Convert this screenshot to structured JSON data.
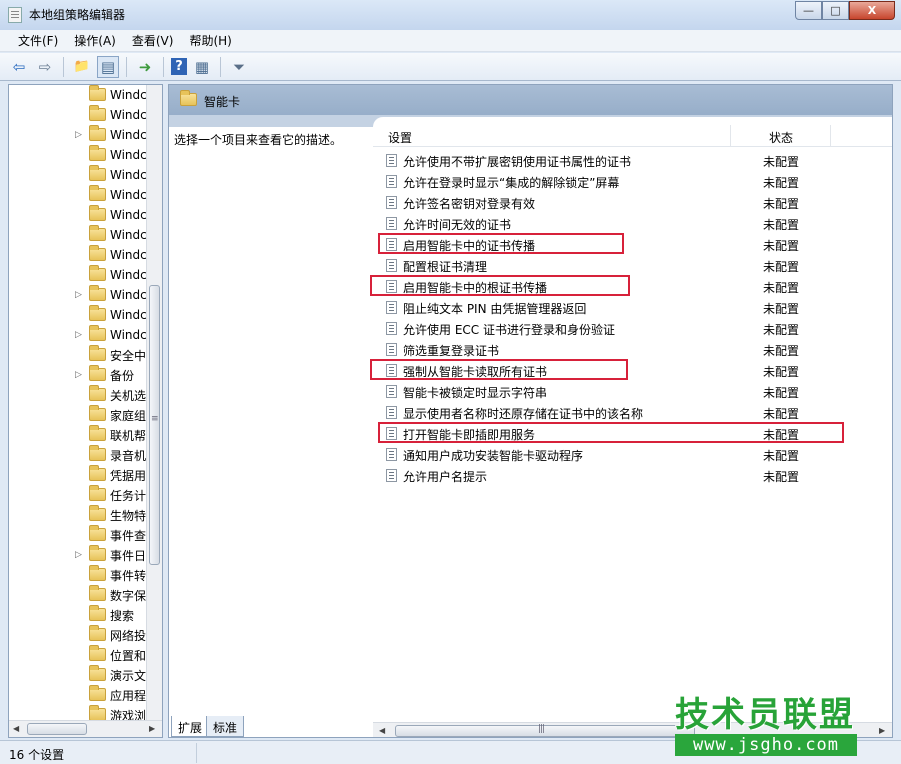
{
  "window": {
    "title": "本地组策略编辑器",
    "minimize": "—",
    "maximize": "□",
    "close": "X"
  },
  "menu": [
    "文件(F)",
    "操作(A)",
    "查看(V)",
    "帮助(H)"
  ],
  "toolbar": {
    "icons": [
      "back-arrow-icon",
      "forward-arrow-icon",
      "folder-up-icon",
      "show-hide-tree-icon",
      "export-list-icon",
      "help-icon",
      "properties-icon",
      "filter-icon"
    ],
    "glyphs": [
      "⇦",
      "⇨",
      "📁",
      "▤",
      "➜",
      "?",
      "▦",
      "⏷"
    ]
  },
  "tree": {
    "items": [
      {
        "label": "Windc",
        "expandable": false
      },
      {
        "label": "Windc",
        "expandable": false
      },
      {
        "label": "Windc",
        "expandable": true
      },
      {
        "label": "Windc",
        "expandable": false
      },
      {
        "label": "Windc",
        "expandable": false
      },
      {
        "label": "Windc",
        "expandable": false
      },
      {
        "label": "Windc",
        "expandable": false
      },
      {
        "label": "Windc",
        "expandable": false
      },
      {
        "label": "Windc",
        "expandable": false
      },
      {
        "label": "Windc",
        "expandable": false
      },
      {
        "label": "Windc",
        "expandable": true
      },
      {
        "label": "Windc",
        "expandable": false
      },
      {
        "label": "Windc",
        "expandable": true
      },
      {
        "label": "安全中",
        "expandable": false
      },
      {
        "label": "备份",
        "expandable": true
      },
      {
        "label": "关机选",
        "expandable": false
      },
      {
        "label": "家庭组",
        "expandable": false
      },
      {
        "label": "联机帮",
        "expandable": false
      },
      {
        "label": "录音机",
        "expandable": false
      },
      {
        "label": "凭据用",
        "expandable": false
      },
      {
        "label": "任务计",
        "expandable": false
      },
      {
        "label": "生物特",
        "expandable": false
      },
      {
        "label": "事件查",
        "expandable": false
      },
      {
        "label": "事件日",
        "expandable": true
      },
      {
        "label": "事件转",
        "expandable": false
      },
      {
        "label": "数字保",
        "expandable": false
      },
      {
        "label": "搜索",
        "expandable": false
      },
      {
        "label": "网络投",
        "expandable": false
      },
      {
        "label": "位置和",
        "expandable": false
      },
      {
        "label": "演示文",
        "expandable": false
      },
      {
        "label": "应用程",
        "expandable": false
      },
      {
        "label": "游戏浏",
        "expandable": false
      }
    ]
  },
  "panel": {
    "title": "智能卡",
    "description": "选择一个项目来查看它的描述。",
    "columns": {
      "setting": "设置",
      "state": "状态"
    },
    "rows": [
      {
        "name": "允许使用不带扩展密钥使用证书属性的证书",
        "state": "未配置",
        "highlighted": false
      },
      {
        "name": "允许在登录时显示“集成的解除锁定”屏幕",
        "state": "未配置",
        "highlighted": false
      },
      {
        "name": "允许签名密钥对登录有效",
        "state": "未配置",
        "highlighted": false
      },
      {
        "name": "允许时间无效的证书",
        "state": "未配置",
        "highlighted": false
      },
      {
        "name": "启用智能卡中的证书传播",
        "state": "未配置",
        "highlighted": true
      },
      {
        "name": "配置根证书清理",
        "state": "未配置",
        "highlighted": false
      },
      {
        "name": "启用智能卡中的根证书传播",
        "state": "未配置",
        "highlighted": true
      },
      {
        "name": "阻止纯文本 PIN 由凭据管理器返回",
        "state": "未配置",
        "highlighted": false
      },
      {
        "name": "允许使用 ECC 证书进行登录和身份验证",
        "state": "未配置",
        "highlighted": false
      },
      {
        "name": "筛选重复登录证书",
        "state": "未配置",
        "highlighted": false
      },
      {
        "name": "强制从智能卡读取所有证书",
        "state": "未配置",
        "highlighted": true
      },
      {
        "name": "智能卡被锁定时显示字符串",
        "state": "未配置",
        "highlighted": false
      },
      {
        "name": "显示使用者名称时还原存储在证书中的该名称",
        "state": "未配置",
        "highlighted": false
      },
      {
        "name": "打开智能卡即插即用服务",
        "state": "未配置",
        "highlighted": true
      },
      {
        "name": "通知用户成功安装智能卡驱动程序",
        "state": "未配置",
        "highlighted": false
      },
      {
        "name": "允许用户名提示",
        "state": "未配置",
        "highlighted": false
      }
    ]
  },
  "tabs": [
    "扩展",
    "标准"
  ],
  "status": "16 个设置",
  "watermark": {
    "top": "技术员联盟",
    "bottom": "www.jsgho.com"
  },
  "colors": {
    "highlight": "#d7213a",
    "header": "#a8bcd4",
    "watermark": "#28a338"
  }
}
